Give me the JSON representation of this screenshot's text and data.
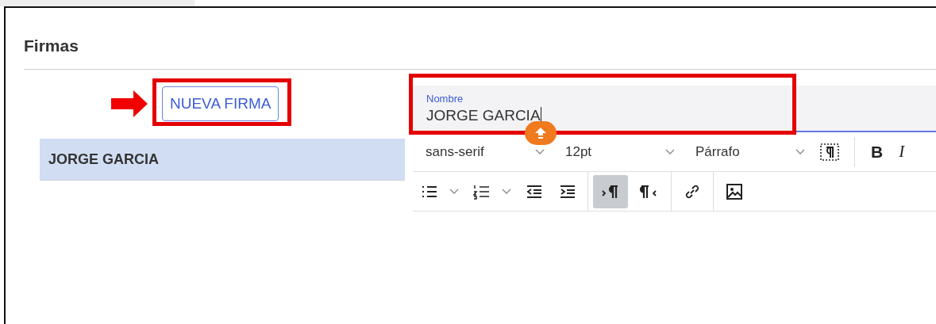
{
  "title": "Firmas",
  "new_button": {
    "label": "NUEVA FIRMA"
  },
  "signatures": [
    {
      "name": "JORGE GARCIA",
      "selected": true
    }
  ],
  "name_field": {
    "label": "Nombre",
    "value": "JORGE GARCIA"
  },
  "toolbar": {
    "font": "sans-serif",
    "size": "12pt",
    "block": "Párrafo",
    "format_buttons": [
      "B",
      "I"
    ],
    "direction": [
      {
        "kind": "ltr",
        "selected": true
      },
      {
        "kind": "rtl",
        "selected": false
      }
    ]
  }
}
